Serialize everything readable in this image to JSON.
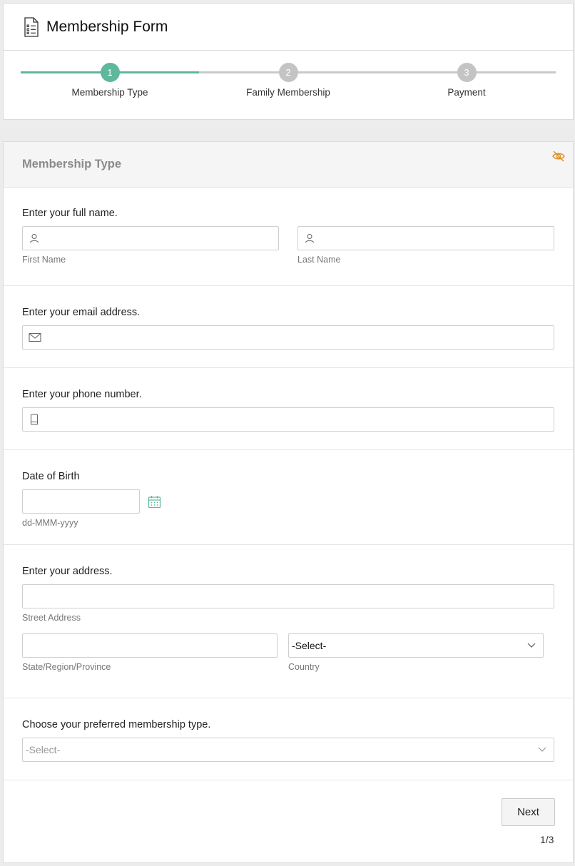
{
  "header": {
    "title": "Membership Form"
  },
  "steps": [
    {
      "number": "1",
      "label": "Membership Type"
    },
    {
      "number": "2",
      "label": "Family Membership"
    },
    {
      "number": "3",
      "label": "Payment"
    }
  ],
  "progress": {
    "current_step": 1,
    "total_steps": 3
  },
  "section": {
    "title": "Membership Type"
  },
  "name_field": {
    "question": "Enter your full name.",
    "first_label": "First Name",
    "last_label": "Last Name"
  },
  "email_field": {
    "question": "Enter your email address."
  },
  "phone_field": {
    "question": "Enter your phone number."
  },
  "dob_field": {
    "question": "Date of Birth",
    "format_hint": "dd-MMM-yyyy"
  },
  "address_field": {
    "question": "Enter your address.",
    "street_label": "Street Address",
    "state_label": "State/Region/Province",
    "country_label": "Country",
    "country_value": "-Select-"
  },
  "membership_field": {
    "question": "Choose your preferred membership type.",
    "value": "-Select-"
  },
  "footer": {
    "next_label": "Next",
    "page_indicator": "1/3"
  },
  "colors": {
    "accent": "#5fb89b",
    "inactive_step": "#c4c4c4",
    "eye_icon": "#d9922b"
  }
}
